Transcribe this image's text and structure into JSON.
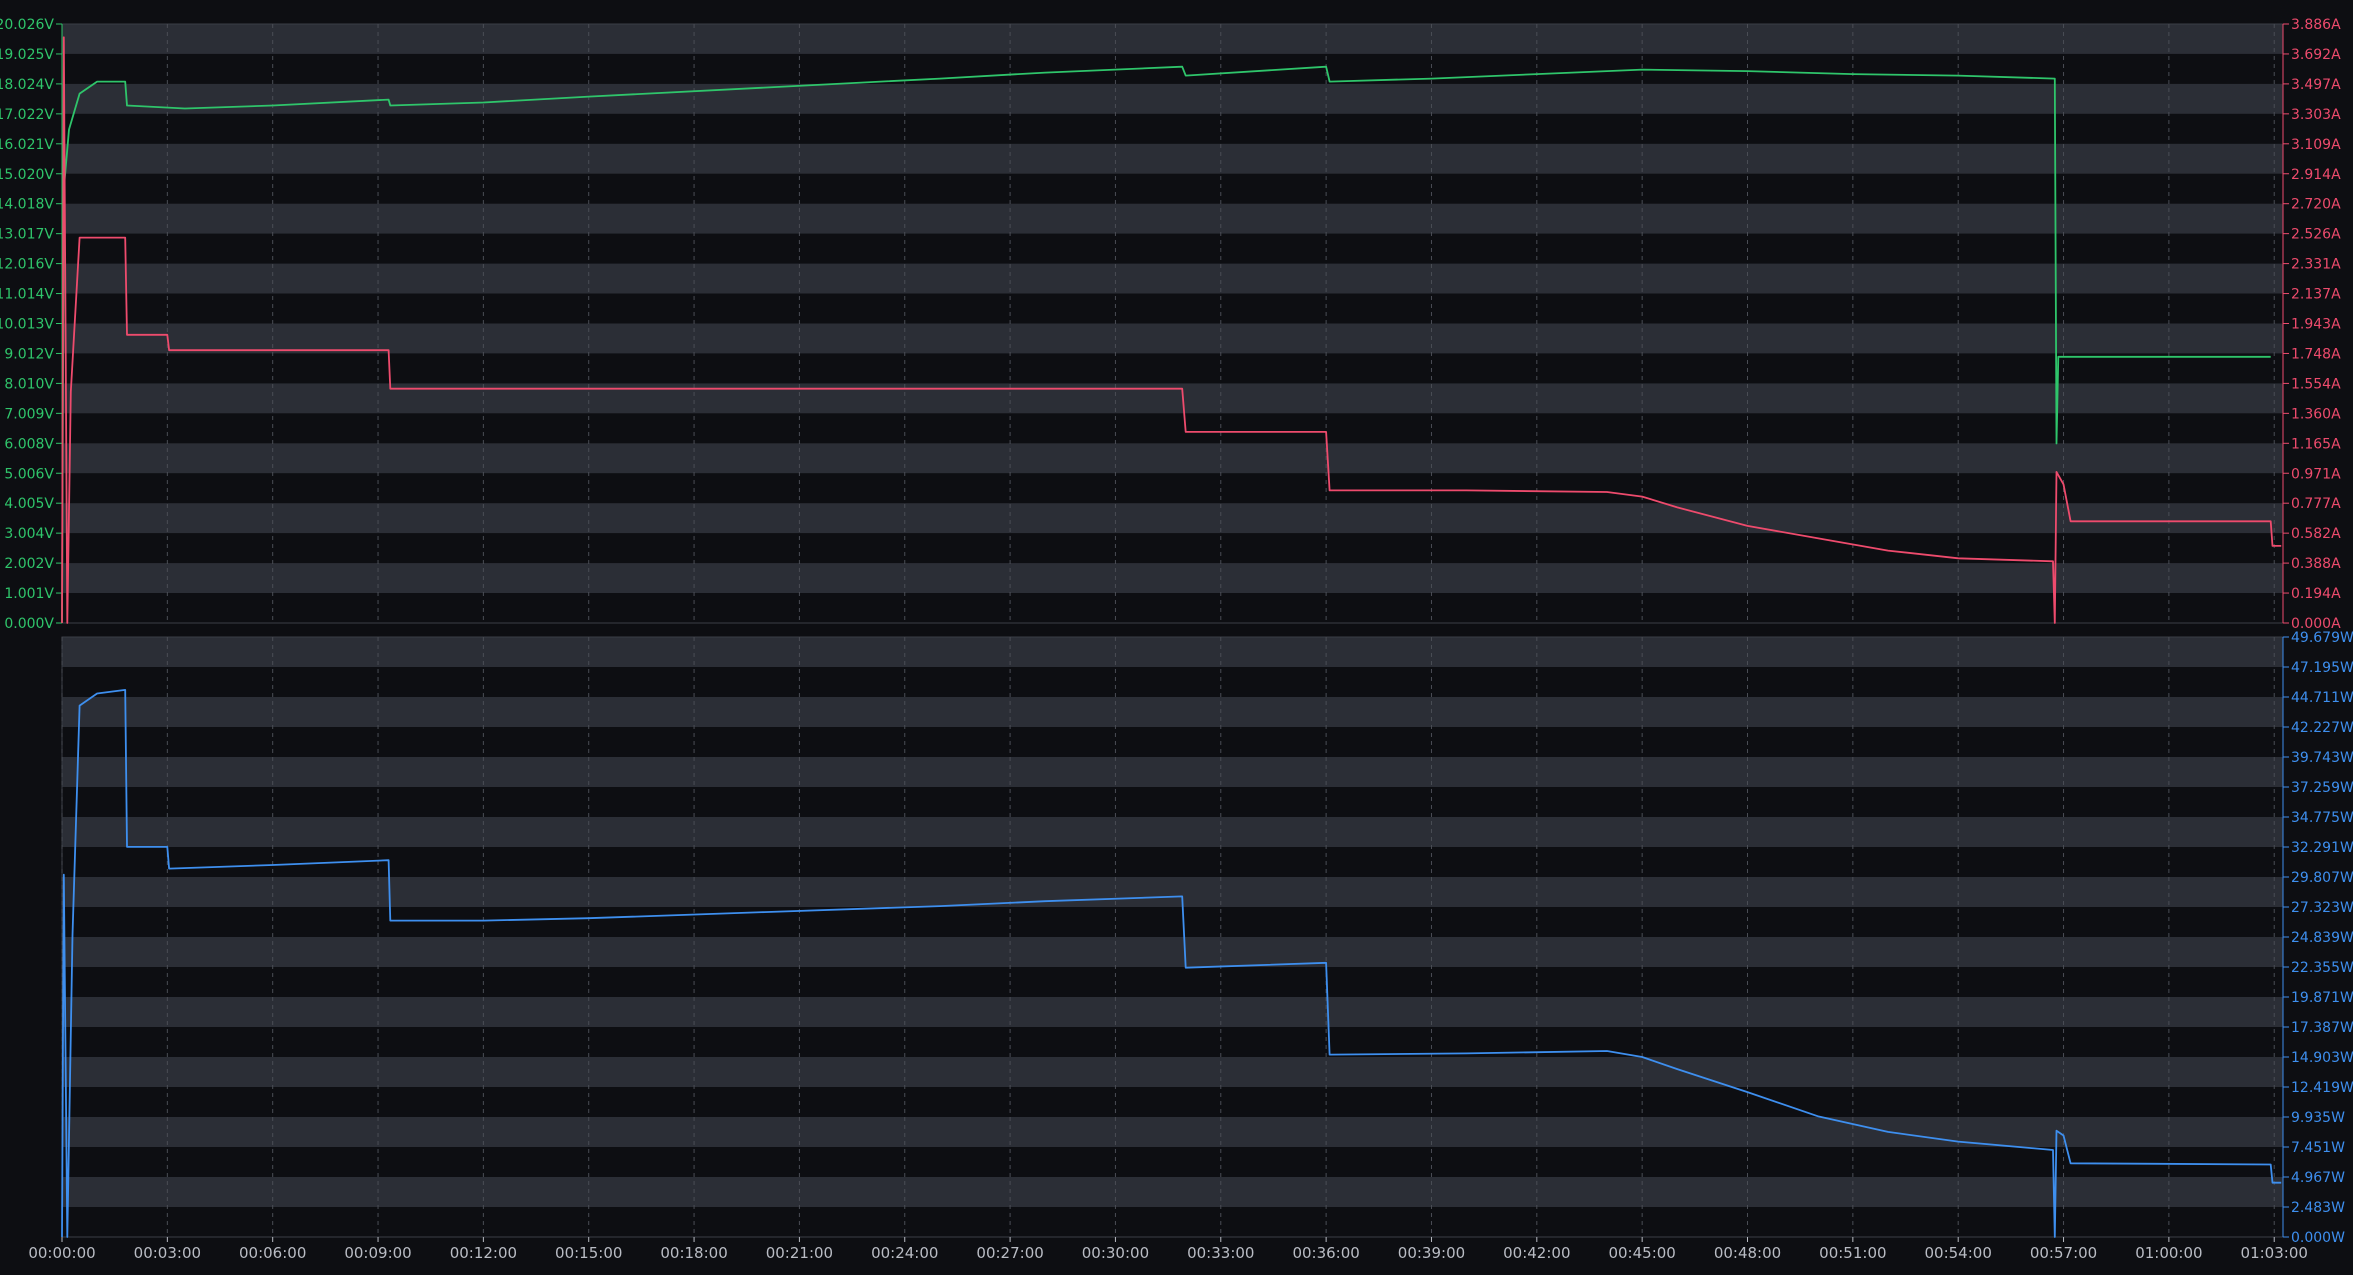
{
  "colors": {
    "background": "#0d0e12",
    "band": "#2b2e36",
    "grid": "#4a4d55",
    "voltage": "#2fc56b",
    "current": "#ee4b6d",
    "power": "#3e8fef",
    "time_label": "#b9bcc4"
  },
  "chart_data": [
    {
      "type": "line",
      "panel": "top",
      "x_ticks": [
        "00:00:00",
        "00:03:00",
        "00:06:00",
        "00:09:00",
        "00:12:00",
        "00:15:00",
        "00:18:00",
        "00:21:00",
        "00:24:00",
        "00:27:00",
        "00:30:00",
        "00:33:00",
        "00:36:00",
        "00:39:00",
        "00:42:00",
        "00:45:00",
        "00:48:00",
        "00:51:00",
        "00:54:00",
        "00:57:00",
        "01:00:00",
        "01:03:00"
      ],
      "xlim": [
        0,
        63.25
      ],
      "grid": true,
      "left_axis": {
        "unit": "V",
        "ylim": [
          0,
          20.026
        ],
        "ticks": [
          "20.026V",
          "19.025V",
          "18.024V",
          "17.022V",
          "16.021V",
          "15.020V",
          "14.018V",
          "13.017V",
          "12.016V",
          "11.014V",
          "10.013V",
          "9.012V",
          "8.010V",
          "7.009V",
          "6.008V",
          "5.006V",
          "4.005V",
          "3.004V",
          "2.002V",
          "1.001V",
          "0.000V"
        ]
      },
      "right_axis": {
        "unit": "A",
        "ylim": [
          0,
          3.886
        ],
        "ticks": [
          "3.886A",
          "3.692A",
          "3.497A",
          "3.303A",
          "3.109A",
          "2.914A",
          "2.720A",
          "2.526A",
          "2.331A",
          "2.137A",
          "1.943A",
          "1.748A",
          "1.554A",
          "1.360A",
          "1.165A",
          "0.971A",
          "0.777A",
          "0.582A",
          "0.388A",
          "0.194A",
          "0.000A"
        ]
      },
      "series": [
        {
          "axis": "left",
          "color": "#2fc56b",
          "points": [
            [
              0,
              0
            ],
            [
              0.05,
              14.5
            ],
            [
              0.2,
              16.5
            ],
            [
              0.5,
              17.7
            ],
            [
              1,
              18.1
            ],
            [
              1.8,
              18.1
            ],
            [
              1.85,
              17.3
            ],
            [
              3.5,
              17.2
            ],
            [
              6,
              17.3
            ],
            [
              9.3,
              17.5
            ],
            [
              9.35,
              17.3
            ],
            [
              12,
              17.4
            ],
            [
              15,
              17.6
            ],
            [
              20,
              17.9
            ],
            [
              25,
              18.2
            ],
            [
              28,
              18.4
            ],
            [
              31.9,
              18.6
            ],
            [
              32,
              18.3
            ],
            [
              36,
              18.6
            ],
            [
              36.1,
              18.1
            ],
            [
              39,
              18.2
            ],
            [
              42,
              18.35
            ],
            [
              45,
              18.5
            ],
            [
              48,
              18.45
            ],
            [
              51,
              18.35
            ],
            [
              54,
              18.3
            ],
            [
              56.75,
              18.2
            ],
            [
              56.8,
              6.0
            ],
            [
              56.85,
              8.9
            ],
            [
              62.9,
              8.9
            ]
          ]
        },
        {
          "axis": "right",
          "color": "#ee4b6d",
          "points": [
            [
              0,
              0
            ],
            [
              0.05,
              3.8
            ],
            [
              0.15,
              0
            ],
            [
              0.25,
              1.5
            ],
            [
              0.5,
              2.5
            ],
            [
              1.8,
              2.5
            ],
            [
              1.85,
              1.87
            ],
            [
              3,
              1.87
            ],
            [
              3.05,
              1.77
            ],
            [
              9.3,
              1.77
            ],
            [
              9.35,
              1.52
            ],
            [
              15,
              1.52
            ],
            [
              20,
              1.52
            ],
            [
              25,
              1.52
            ],
            [
              31.9,
              1.52
            ],
            [
              32,
              1.24
            ],
            [
              36,
              1.24
            ],
            [
              36.1,
              0.86
            ],
            [
              40,
              0.86
            ],
            [
              44,
              0.85
            ],
            [
              45,
              0.82
            ],
            [
              46,
              0.75
            ],
            [
              48,
              0.63
            ],
            [
              50,
              0.55
            ],
            [
              52,
              0.47
            ],
            [
              54,
              0.42
            ],
            [
              56.7,
              0.4
            ],
            [
              56.75,
              0
            ],
            [
              56.8,
              0.98
            ],
            [
              57,
              0.9
            ],
            [
              57.2,
              0.66
            ],
            [
              62.9,
              0.66
            ],
            [
              62.95,
              0.5
            ],
            [
              63.2,
              0.5
            ]
          ]
        }
      ]
    },
    {
      "type": "line",
      "panel": "bottom",
      "x_ticks": [
        "00:00:00",
        "00:03:00",
        "00:06:00",
        "00:09:00",
        "00:12:00",
        "00:15:00",
        "00:18:00",
        "00:21:00",
        "00:24:00",
        "00:27:00",
        "00:30:00",
        "00:33:00",
        "00:36:00",
        "00:39:00",
        "00:42:00",
        "00:45:00",
        "00:48:00",
        "00:51:00",
        "00:54:00",
        "00:57:00",
        "01:00:00",
        "01:03:00"
      ],
      "xlim": [
        0,
        63.25
      ],
      "grid": true,
      "right_axis": {
        "unit": "W",
        "ylim": [
          0,
          49.679
        ],
        "ticks": [
          "49.679W",
          "47.195W",
          "44.711W",
          "42.227W",
          "39.743W",
          "37.259W",
          "34.775W",
          "32.291W",
          "29.807W",
          "27.323W",
          "24.839W",
          "22.355W",
          "19.871W",
          "17.387W",
          "14.903W",
          "12.419W",
          "9.935W",
          "7.451W",
          "4.967W",
          "2.483W",
          "0.000W"
        ]
      },
      "series": [
        {
          "axis": "right",
          "color": "#3e8fef",
          "points": [
            [
              0,
              0
            ],
            [
              0.05,
              30
            ],
            [
              0.15,
              0
            ],
            [
              0.3,
              25
            ],
            [
              0.5,
              44
            ],
            [
              1,
              45
            ],
            [
              1.8,
              45.3
            ],
            [
              1.85,
              32.3
            ],
            [
              3,
              32.3
            ],
            [
              3.05,
              30.5
            ],
            [
              6,
              30.8
            ],
            [
              9.3,
              31.2
            ],
            [
              9.35,
              26.2
            ],
            [
              12,
              26.2
            ],
            [
              15,
              26.4
            ],
            [
              20,
              26.9
            ],
            [
              25,
              27.4
            ],
            [
              28,
              27.8
            ],
            [
              31.9,
              28.2
            ],
            [
              32,
              22.3
            ],
            [
              36,
              22.7
            ],
            [
              36.1,
              15.1
            ],
            [
              40,
              15.2
            ],
            [
              44,
              15.4
            ],
            [
              45,
              14.9
            ],
            [
              46,
              13.9
            ],
            [
              48,
              12.0
            ],
            [
              50,
              10.0
            ],
            [
              52,
              8.7
            ],
            [
              54,
              7.9
            ],
            [
              56.7,
              7.2
            ],
            [
              56.75,
              0
            ],
            [
              56.8,
              8.8
            ],
            [
              57,
              8.4
            ],
            [
              57.2,
              6.1
            ],
            [
              62.9,
              6.0
            ],
            [
              62.95,
              4.5
            ],
            [
              63.2,
              4.5
            ]
          ]
        }
      ]
    }
  ]
}
